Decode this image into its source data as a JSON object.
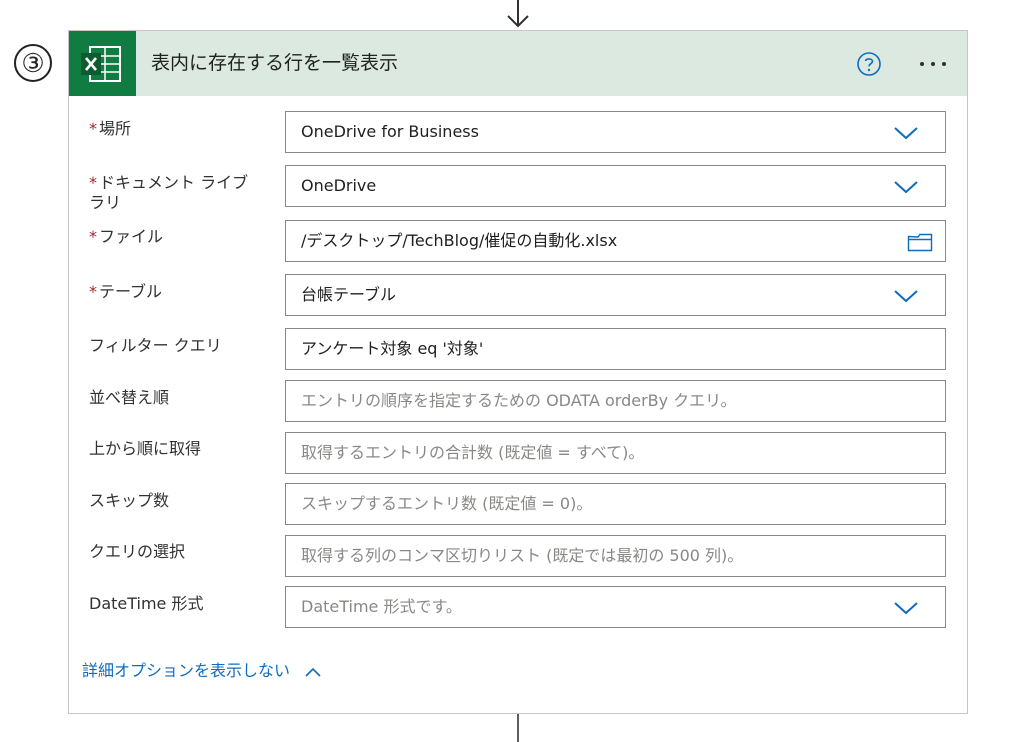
{
  "step": {
    "number_glyph": "③"
  },
  "action": {
    "title": "表内に存在する行を一覧表示",
    "icon": "excel-icon",
    "header_bg": "#dbe9e1",
    "icon_bg": "#107c41"
  },
  "fields": {
    "location": {
      "required_mark": "*",
      "label": "場所",
      "value": "OneDrive for Business"
    },
    "library": {
      "required_mark": "*",
      "label_line1": "ドキュメント ライブ",
      "label_line2": "ラリ",
      "value": "OneDrive"
    },
    "file": {
      "required_mark": "*",
      "label": "ファイル",
      "value": "/デスクトップ/TechBlog/催促の自動化.xlsx"
    },
    "table": {
      "required_mark": "*",
      "label": "テーブル",
      "value": "台帳テーブル"
    },
    "filter": {
      "label": "フィルター クエリ",
      "value": "アンケート対象 eq '対象'"
    },
    "order_by": {
      "label": "並べ替え順",
      "placeholder": "エントリの順序を指定するための ODATA orderBy クエリ。"
    },
    "top": {
      "label": "上から順に取得",
      "placeholder": "取得するエントリの合計数 (既定値 = すべて)。"
    },
    "skip": {
      "label": "スキップ数",
      "placeholder": "スキップするエントリ数 (既定値 = 0)。"
    },
    "select": {
      "label": "クエリの選択",
      "placeholder": "取得する列のコンマ区切りリスト (既定では最初の 500 列)。"
    },
    "datetime": {
      "label": "DateTime 形式",
      "placeholder": "DateTime 形式です。"
    }
  },
  "advanced": {
    "label": "詳細オプションを表示しない"
  },
  "colors": {
    "accent": "#0f6cbd",
    "required": "#a4262c"
  }
}
